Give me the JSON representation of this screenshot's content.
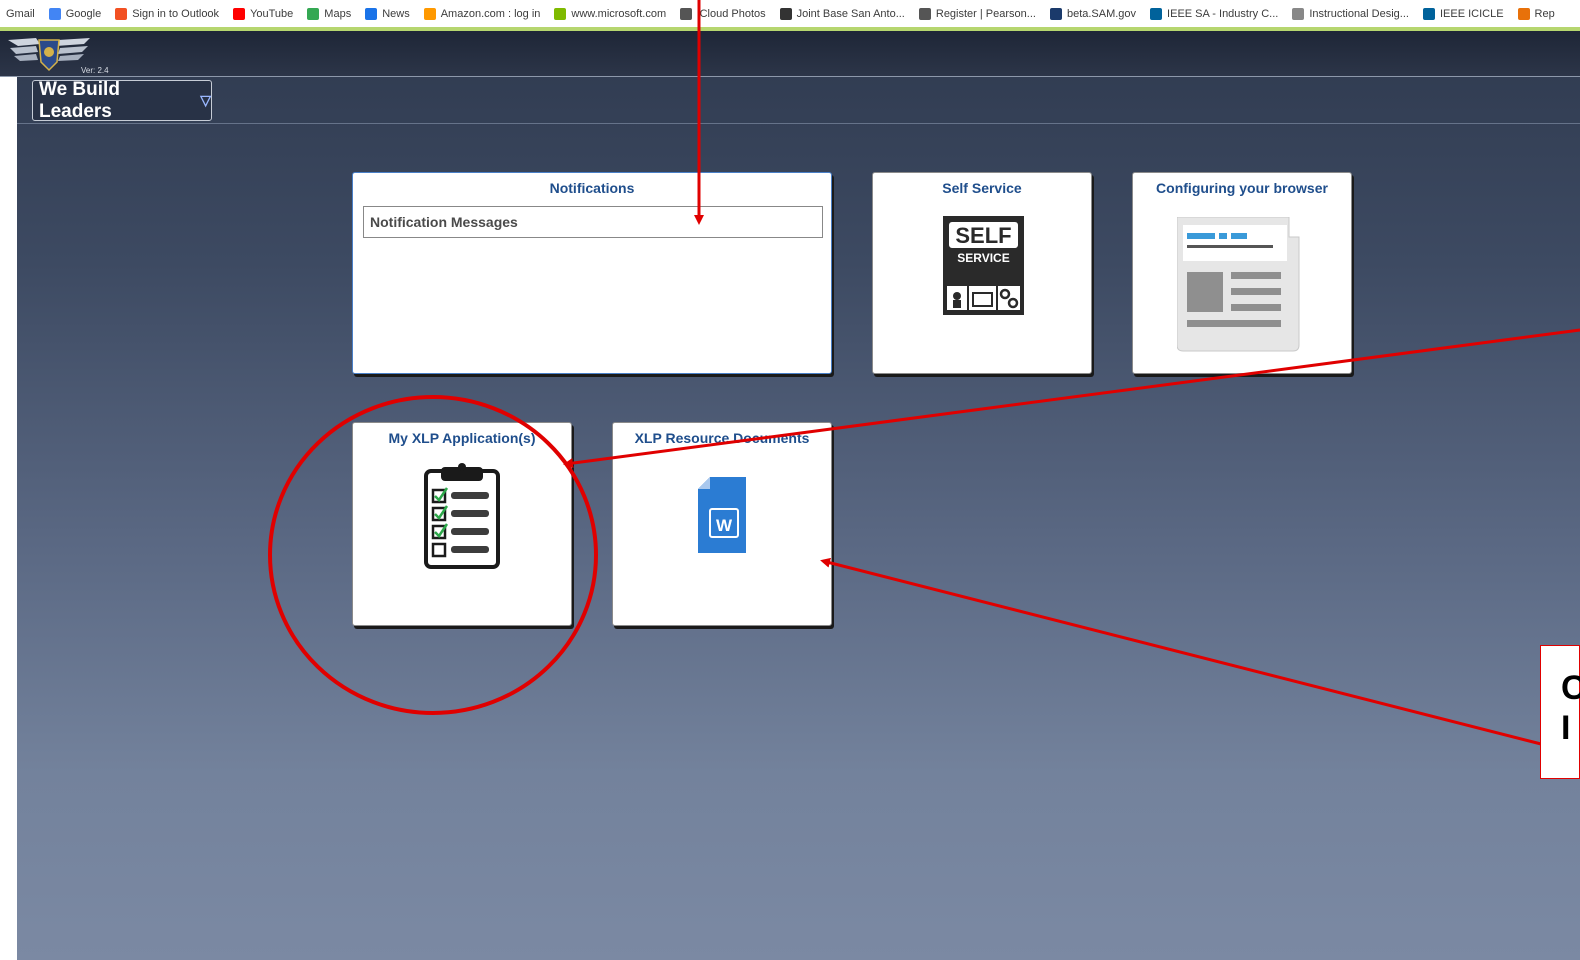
{
  "bookmarks": [
    {
      "label": "Gmail",
      "icon": "gmail-icon",
      "color": "#ffffff"
    },
    {
      "label": "Google",
      "icon": "google-icon",
      "color": "#4285f4"
    },
    {
      "label": "Sign in to Outlook",
      "icon": "microsoft-icon",
      "color": "#f25022"
    },
    {
      "label": "YouTube",
      "icon": "youtube-icon",
      "color": "#ff0000"
    },
    {
      "label": "Maps",
      "icon": "maps-icon",
      "color": "#34a853"
    },
    {
      "label": "News",
      "icon": "news-icon",
      "color": "#1a73e8"
    },
    {
      "label": "Amazon.com : log in",
      "icon": "amazon-icon",
      "color": "#ff9900"
    },
    {
      "label": "www.microsoft.com",
      "icon": "microsoft-icon",
      "color": "#7fba00"
    },
    {
      "label": "iCloud Photos",
      "icon": "apple-icon",
      "color": "#555555"
    },
    {
      "label": "Joint Base San Anto...",
      "icon": "jbsa-icon",
      "color": "#333333"
    },
    {
      "label": "Register | Pearson...",
      "icon": "pearson-icon",
      "color": "#555555"
    },
    {
      "label": "beta.SAM.gov",
      "icon": "sam-icon",
      "color": "#1b3a6b"
    },
    {
      "label": "IEEE SA - Industry C...",
      "icon": "ieee-icon",
      "color": "#00629b"
    },
    {
      "label": "Instructional Desig...",
      "icon": "globe-icon",
      "color": "#888888"
    },
    {
      "label": "IEEE ICICLE",
      "icon": "ieee-icon",
      "color": "#00629b"
    },
    {
      "label": "Rep",
      "icon": "bookmark-icon",
      "color": "#e8710a"
    }
  ],
  "header": {
    "version": "Ver: 2.4",
    "home_title": "We Build Leaders",
    "home_caret": "▽"
  },
  "tiles": {
    "notifications": {
      "title": "Notifications",
      "message_label": "Notification Messages"
    },
    "self_service": {
      "title": "Self Service",
      "icon_text_1": "SELF",
      "icon_text_2": "SERVICE"
    },
    "configure_browser": {
      "title": "Configuring your browser"
    },
    "xlp_applications": {
      "title": "My XLP Application(s)"
    },
    "xlp_resources": {
      "title": "XLP Resource Documents",
      "icon_letter": "W"
    }
  },
  "annotation": {
    "box_text": "C\nI",
    "color": "#e00000"
  }
}
